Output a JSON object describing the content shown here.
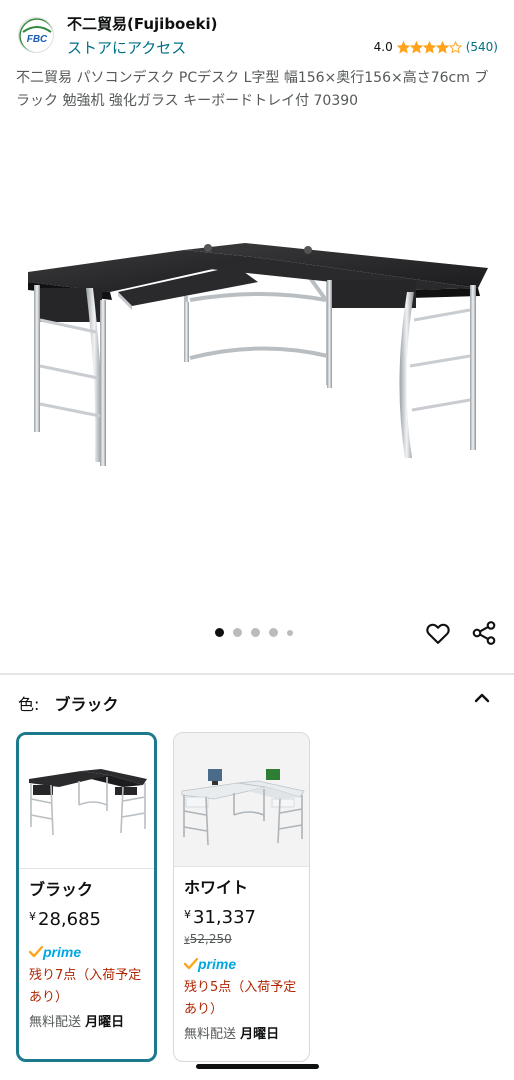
{
  "store": {
    "logo_text": "FBC",
    "name": "不二貿易(Fujiboeki)",
    "link_label": "ストアにアクセス",
    "rating": "4.0",
    "stars": 4,
    "review_count": "(540)"
  },
  "product": {
    "title": "不二貿易 パソコンデスク PCデスク L字型 幅156×奥行156×高さ76cm ブラック 勉強机 強化ガラス キーボードトレイ付 70390"
  },
  "gallery": {
    "image_count": 5,
    "active_index": 0,
    "icons": [
      "heart-icon",
      "share-icon"
    ]
  },
  "color_selector": {
    "label": "色:",
    "value": "ブラック",
    "icon": "chevron-up-icon"
  },
  "variants": [
    {
      "name": "ブラック",
      "currency": "¥",
      "price": "28,685",
      "old_price": "",
      "prime": "prime",
      "stock": "残り7点（入荷予定あり）",
      "shipping_prefix": "無料配送",
      "shipping_day": "月曜日"
    },
    {
      "name": "ホワイト",
      "currency": "¥",
      "price": "31,337",
      "old_price": "52,250",
      "prime": "prime",
      "stock": "残り5点（入荷予定あり）",
      "shipping_prefix": "無料配送",
      "shipping_day": "月曜日"
    }
  ],
  "colors": {
    "link": "#007185",
    "star": "#ffa41c",
    "selected_border": "#1c7a8c",
    "stock_red": "#b12704",
    "prime_blue": "#00a8e1"
  }
}
